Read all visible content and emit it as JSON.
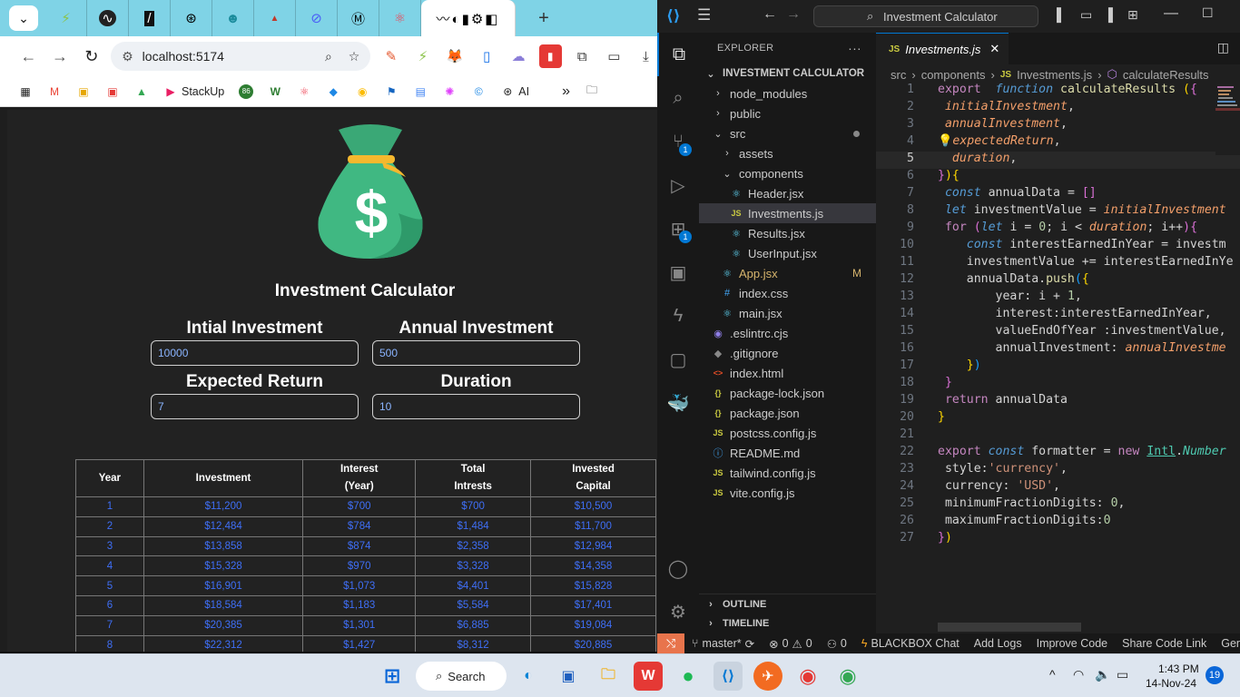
{
  "browser": {
    "url": "localhost:5174",
    "bookmarks": [
      {
        "label": "",
        "icon": "apps-grid-icon"
      },
      {
        "label": "",
        "icon": "gmail-icon"
      },
      {
        "label": "",
        "icon": "bookmark-icon-2"
      },
      {
        "label": "",
        "icon": "bookmark-icon-3"
      },
      {
        "label": "",
        "icon": "drive-icon"
      },
      {
        "label": "StackUp",
        "icon": "stackup-icon"
      },
      {
        "label": "",
        "icon": "badge-86-icon"
      },
      {
        "label": "",
        "icon": "w-icon"
      },
      {
        "label": "",
        "icon": "react-icon"
      },
      {
        "label": "",
        "icon": "bookmark-icon-10"
      },
      {
        "label": "",
        "icon": "chrome-icon"
      },
      {
        "label": "",
        "icon": "flag-icon"
      },
      {
        "label": "",
        "icon": "docs-icon"
      },
      {
        "label": "",
        "icon": "swirl-icon"
      },
      {
        "label": "",
        "icon": "c-icon"
      },
      {
        "label": "AI",
        "icon": "openai-icon"
      }
    ]
  },
  "app": {
    "title": "Investment Calculator",
    "fields": {
      "initial_label": "Intial Investment",
      "initial_value": "10000",
      "annual_label": "Annual Investment",
      "annual_value": "500",
      "expected_label": "Expected Return",
      "expected_value": "7",
      "duration_label": "Duration",
      "duration_value": "10"
    },
    "table": {
      "headers": [
        "Year",
        "Investment",
        "Interest (Year)",
        "Total Intrests",
        "Invested Capital"
      ],
      "rows": [
        [
          "1",
          "$11,200",
          "$700",
          "$700",
          "$10,500"
        ],
        [
          "2",
          "$12,484",
          "$784",
          "$1,484",
          "$11,700"
        ],
        [
          "3",
          "$13,858",
          "$874",
          "$2,358",
          "$12,984"
        ],
        [
          "4",
          "$15,328",
          "$970",
          "$3,328",
          "$14,358"
        ],
        [
          "5",
          "$16,901",
          "$1,073",
          "$4,401",
          "$15,828"
        ],
        [
          "6",
          "$18,584",
          "$1,183",
          "$5,584",
          "$17,401"
        ],
        [
          "7",
          "$20,385",
          "$1,301",
          "$6,885",
          "$19,084"
        ],
        [
          "8",
          "$22,312",
          "$1,427",
          "$8,312",
          "$20,885"
        ]
      ]
    }
  },
  "vscode": {
    "search": "Investment Calculator",
    "explorer_label": "EXPLORER",
    "project": "INVESTMENT CALCULATOR",
    "tree": [
      {
        "label": "node_modules",
        "depth": 0,
        "type": "folder"
      },
      {
        "label": "public",
        "depth": 0,
        "type": "folder"
      },
      {
        "label": "src",
        "depth": 0,
        "type": "folder-open",
        "dot": true
      },
      {
        "label": "assets",
        "depth": 1,
        "type": "folder"
      },
      {
        "label": "components",
        "depth": 1,
        "type": "folder-open"
      },
      {
        "label": "Header.jsx",
        "depth": 2,
        "type": "react"
      },
      {
        "label": "Investments.js",
        "depth": 2,
        "type": "js",
        "selected": true
      },
      {
        "label": "Results.jsx",
        "depth": 2,
        "type": "react"
      },
      {
        "label": "UserInput.jsx",
        "depth": 2,
        "type": "react"
      },
      {
        "label": "App.jsx",
        "depth": 1,
        "type": "react",
        "mod": "M"
      },
      {
        "label": "index.css",
        "depth": 1,
        "type": "css"
      },
      {
        "label": "main.jsx",
        "depth": 1,
        "type": "react"
      },
      {
        "label": ".eslintrc.cjs",
        "depth": 0,
        "type": "eslint"
      },
      {
        "label": ".gitignore",
        "depth": 0,
        "type": "git"
      },
      {
        "label": "index.html",
        "depth": 0,
        "type": "html"
      },
      {
        "label": "package-lock.json",
        "depth": 0,
        "type": "json"
      },
      {
        "label": "package.json",
        "depth": 0,
        "type": "json"
      },
      {
        "label": "postcss.config.js",
        "depth": 0,
        "type": "js"
      },
      {
        "label": "README.md",
        "depth": 0,
        "type": "md"
      },
      {
        "label": "tailwind.config.js",
        "depth": 0,
        "type": "js"
      },
      {
        "label": "vite.config.js",
        "depth": 0,
        "type": "js"
      }
    ],
    "outline": "OUTLINE",
    "timeline": "TIMELINE",
    "tab": "Investments.js",
    "breadcrumb": [
      "src",
      "components",
      "Investments.js",
      "calculateResults"
    ],
    "current_line": 5,
    "status": {
      "branch": "master*",
      "errors": "0",
      "warnings": "0",
      "ports": "0",
      "items": [
        "BLACKBOX Chat",
        "Add Logs",
        "Improve Code",
        "Share Code Link",
        "Gene"
      ]
    }
  },
  "taskbar": {
    "search": "Search",
    "time": "1:43 PM",
    "date": "14-Nov-24",
    "notifications": "19"
  }
}
